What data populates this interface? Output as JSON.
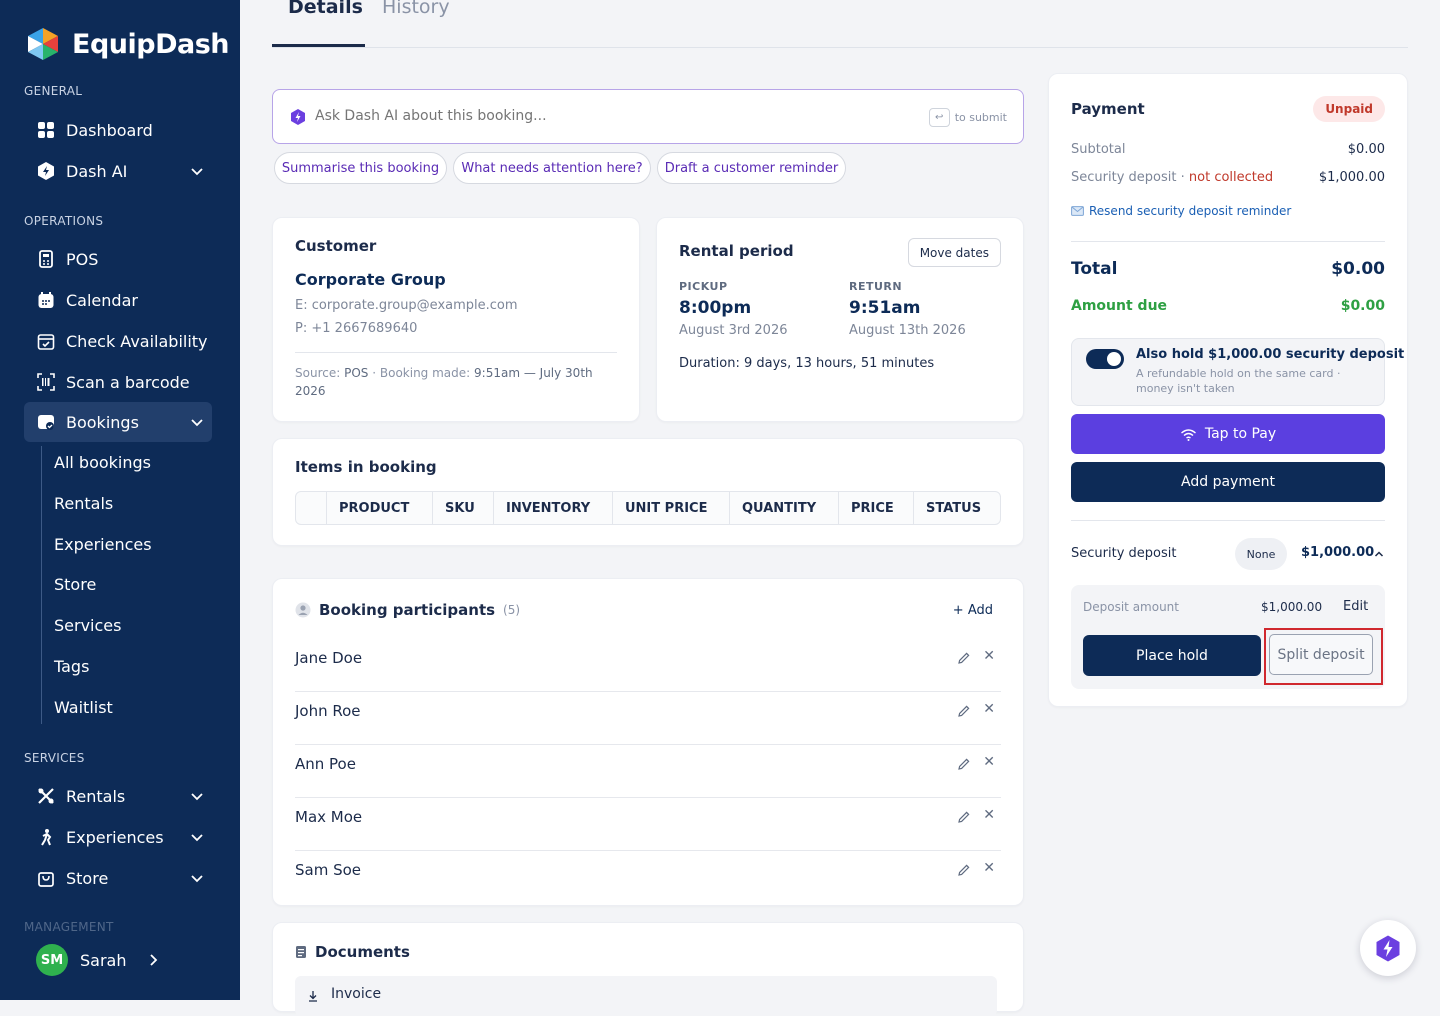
{
  "brand": {
    "name": "EquipDash"
  },
  "sidebar": {
    "sections": {
      "general": "GENERAL",
      "operations": "OPERATIONS",
      "services": "SERVICES",
      "management": "MANAGEMENT"
    },
    "items": {
      "dashboard": "Dashboard",
      "dash_ai": "Dash AI",
      "pos": "POS",
      "calendar": "Calendar",
      "check_availability": "Check Availability",
      "scan_barcode": "Scan a barcode",
      "bookings": "Bookings",
      "rentals_nav": "Rentals",
      "experiences_nav": "Experiences",
      "store_nav": "Store"
    },
    "bookings_sub": [
      "All bookings",
      "Rentals",
      "Experiences",
      "Store",
      "Services",
      "Tags",
      "Waitlist"
    ],
    "user": {
      "initials": "SM",
      "name": "Sarah"
    }
  },
  "tabs": {
    "details": "Details",
    "history": "History"
  },
  "ai": {
    "placeholder": "Ask Dash AI about this booking...",
    "submit_hint": "to submit",
    "suggestions": [
      "Summarise this booking",
      "What needs attention here?",
      "Draft a customer reminder"
    ]
  },
  "customer": {
    "heading": "Customer",
    "name": "Corporate Group",
    "email_label": "E:",
    "email": "corporate.group@example.com",
    "phone_label": "P:",
    "phone": "+1 2667689640",
    "source_label": "Source:",
    "source": "POS",
    "booking_made_label": "Booking made:",
    "booking_made_time": "9:51am — July 30th",
    "booking_made_year": "2026"
  },
  "rental": {
    "heading": "Rental period",
    "move_dates": "Move dates",
    "pickup_label": "PICKUP",
    "pickup_time": "8:00pm",
    "pickup_date": "August 3rd 2026",
    "return_label": "RETURN",
    "return_time": "9:51am",
    "return_date": "August 13th 2026",
    "duration_label": "Duration:",
    "duration": "9 days, 13 hours, 51 minutes"
  },
  "items": {
    "heading": "Items in booking",
    "columns": [
      "PRODUCT",
      "SKU",
      "INVENTORY",
      "UNIT PRICE",
      "QUANTITY",
      "PRICE",
      "STATUS"
    ]
  },
  "participants": {
    "heading": "Booking participants",
    "count": "(5)",
    "add": "+ Add",
    "people": [
      "Jane Doe",
      "John Roe",
      "Ann Poe",
      "Max Moe",
      "Sam Soe"
    ]
  },
  "documents": {
    "heading": "Documents",
    "items": [
      "Invoice"
    ]
  },
  "payment": {
    "heading": "Payment",
    "status": "Unpaid",
    "subtotal_label": "Subtotal",
    "subtotal": "$0.00",
    "deposit_label": "Security deposit",
    "deposit_sep": "·",
    "deposit_status": "not collected",
    "deposit_amount": "$1,000.00",
    "resend_link": "Resend security deposit reminder",
    "total_label": "Total",
    "total": "$0.00",
    "amount_due_label": "Amount due",
    "amount_due": "$0.00",
    "hold_title": "Also hold $1,000.00 security deposit",
    "hold_desc_1": "A refundable hold on the same card ·",
    "hold_desc_2": "money isn't taken",
    "hold_enabled": true,
    "tap_to_pay": "Tap to Pay",
    "add_payment": "Add payment",
    "sd_label": "Security deposit",
    "sd_badge": "None",
    "sd_amount": "$1,000.00",
    "deposit_amount_label": "Deposit amount",
    "deposit_amount_value": "$1,000.00",
    "edit": "Edit",
    "place_hold": "Place hold",
    "split_deposit": "Split deposit"
  },
  "colors": {
    "sidebar": "#0d2b57",
    "primary": "#0d2b57",
    "accent_purple": "#5b3fe0",
    "success": "#2ea043",
    "danger": "#c0392b",
    "link": "#1a5fb4",
    "highlight": "#d0282e"
  }
}
